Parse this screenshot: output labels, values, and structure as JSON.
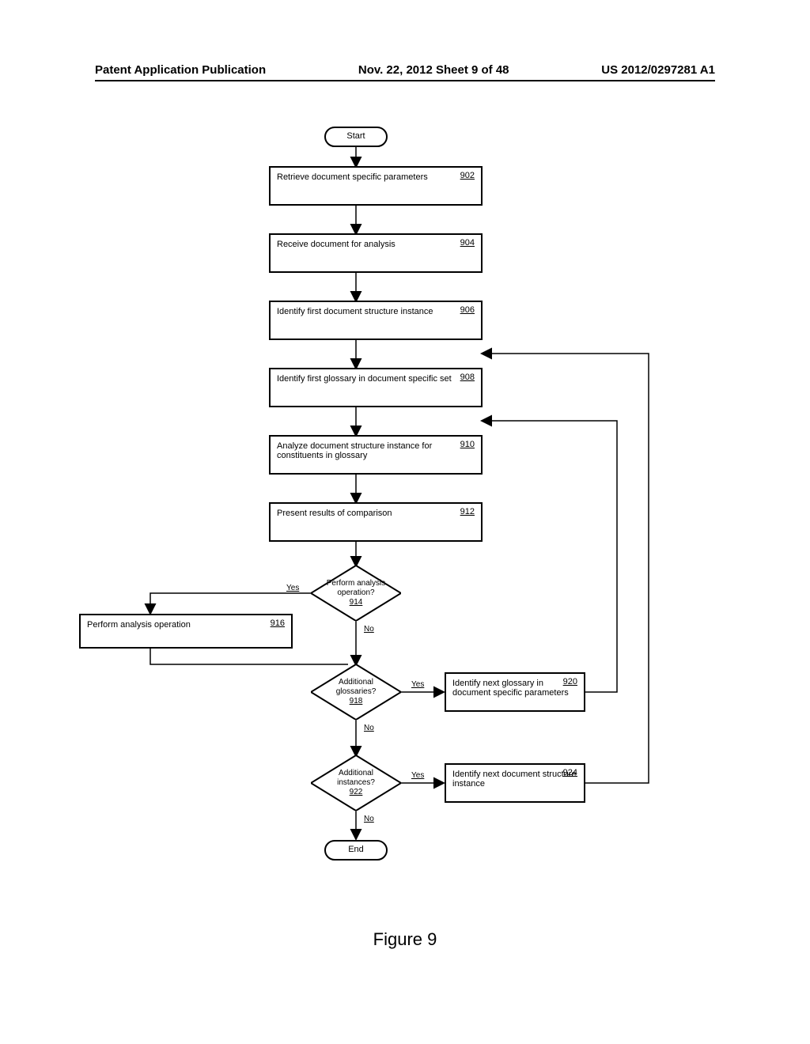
{
  "header": {
    "left": "Patent Application Publication",
    "center": "Nov. 22, 2012  Sheet 9 of 48",
    "right": "US 2012/0297281 A1"
  },
  "flow": {
    "start": "Start",
    "end": "End",
    "box902": {
      "text": "Retrieve document specific parameters",
      "ref": "902"
    },
    "box904": {
      "text": "Receive document for analysis",
      "ref": "904"
    },
    "box906": {
      "text": "Identify first document structure instance",
      "ref": "906"
    },
    "box908": {
      "text": "Identify first glossary in document specific set",
      "ref": "908"
    },
    "box910": {
      "text": "Analyze document structure instance for constituents in glossary",
      "ref": "910"
    },
    "box912": {
      "text": "Present results of comparison",
      "ref": "912"
    },
    "box916": {
      "text": "Perform analysis operation",
      "ref": "916"
    },
    "box920": {
      "text": "Identify next glossary in document specific parameters",
      "ref": "920"
    },
    "box924": {
      "text": "Identify next document structure instance",
      "ref": "924"
    },
    "dia914": {
      "l1": "Perform analysis",
      "l2": "operation?",
      "ref": "914"
    },
    "dia918": {
      "l1": "Additional",
      "l2": "glossaries?",
      "ref": "918"
    },
    "dia922": {
      "l1": "Additional",
      "l2": "instances?",
      "ref": "922"
    },
    "yes": "Yes",
    "no": "No"
  },
  "caption": "Figure 9"
}
